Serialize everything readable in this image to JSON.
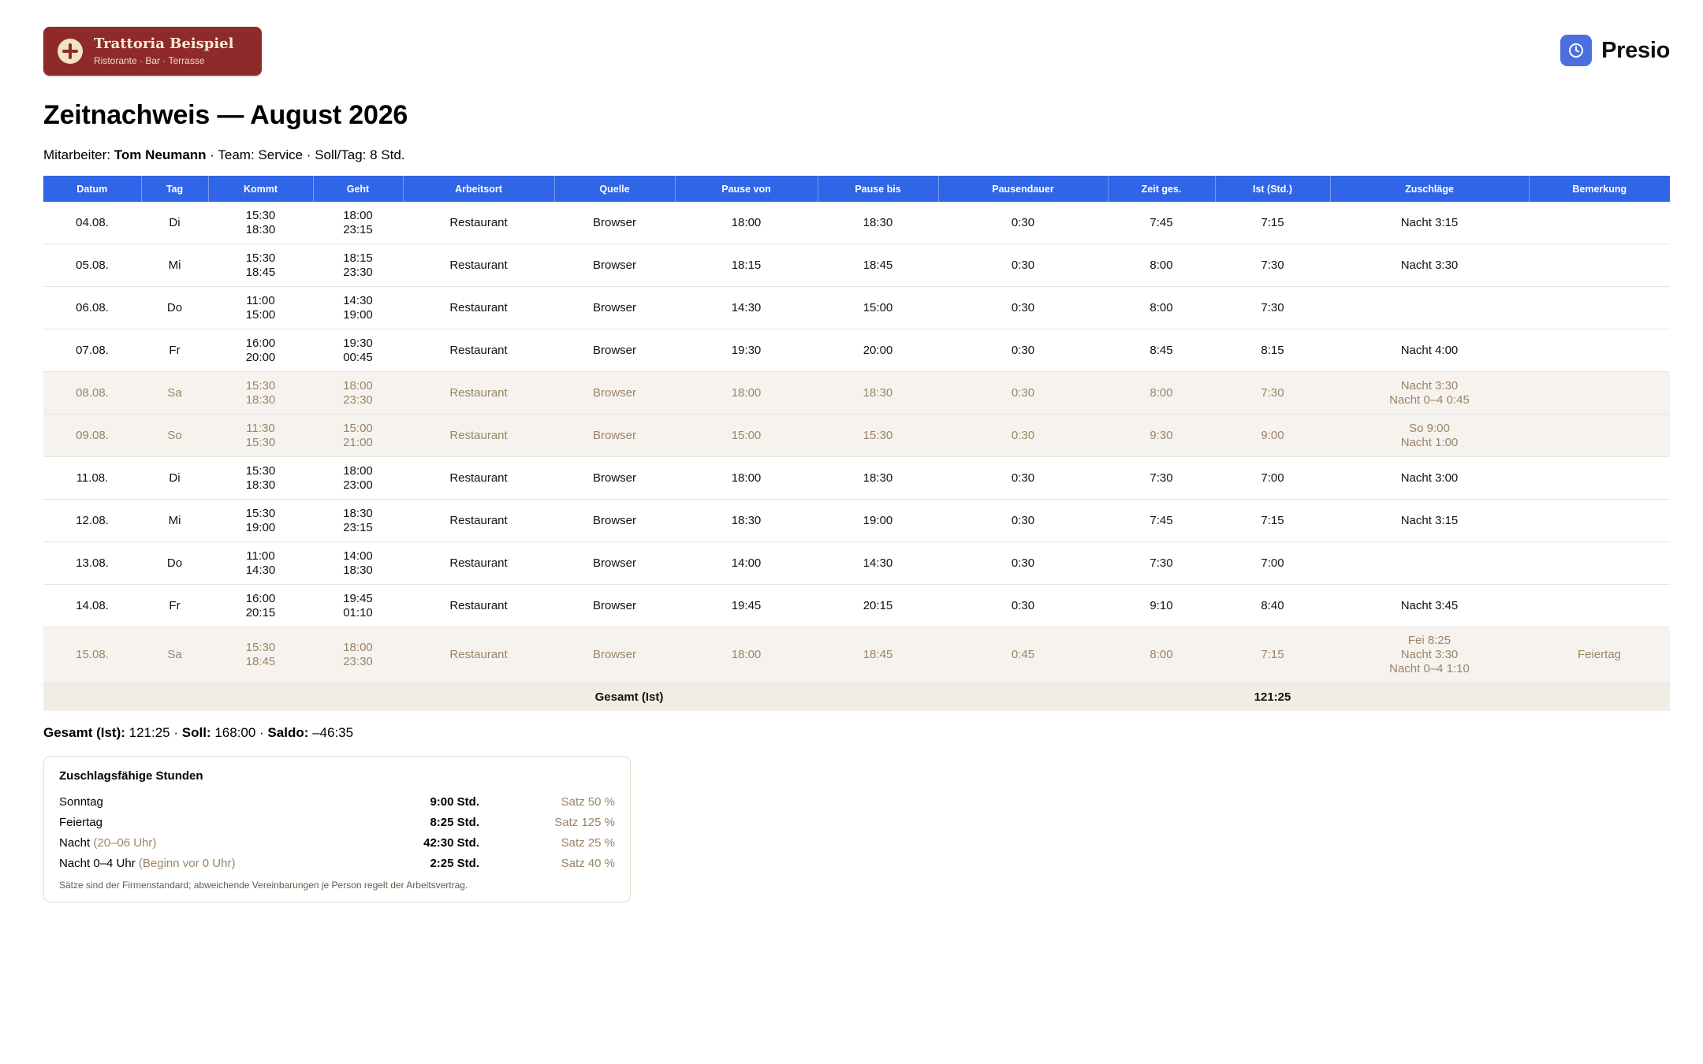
{
  "header": {
    "logo_name": "Trattoria Beispiel",
    "logo_subtitle": "Ristorante · Bar · Terrasse",
    "brand_name": "Presio"
  },
  "title": "Zeitnachweis — August 2026",
  "meta": {
    "employee_label": "Mitarbeiter:",
    "employee_name": "Tom Neumann",
    "rest": " · Team: Service · Soll/Tag: 8 Std."
  },
  "table": {
    "columns": [
      "Datum",
      "Tag",
      "Kommt",
      "Geht",
      "Arbeitsort",
      "Quelle",
      "Pause von",
      "Pause bis",
      "Pausendauer",
      "Zeit ges.",
      "Ist (Std.)",
      "Zuschläge",
      "Bemerkung"
    ],
    "rows": [
      {
        "datum": "04.08.",
        "tag": "Di",
        "kommt": [
          "15:30",
          "18:30"
        ],
        "geht": [
          "18:00",
          "23:15"
        ],
        "ort": "Restaurant",
        "quelle": "Browser",
        "pause_von": "18:00",
        "pause_bis": "18:30",
        "pausendauer": "0:30",
        "zeit": "7:45",
        "ist": "7:15",
        "zuschlaege": [
          "Nacht 3:15"
        ],
        "bemerkung": "",
        "weekend": false
      },
      {
        "datum": "05.08.",
        "tag": "Mi",
        "kommt": [
          "15:30",
          "18:45"
        ],
        "geht": [
          "18:15",
          "23:30"
        ],
        "ort": "Restaurant",
        "quelle": "Browser",
        "pause_von": "18:15",
        "pause_bis": "18:45",
        "pausendauer": "0:30",
        "zeit": "8:00",
        "ist": "7:30",
        "zuschlaege": [
          "Nacht 3:30"
        ],
        "bemerkung": "",
        "weekend": false
      },
      {
        "datum": "06.08.",
        "tag": "Do",
        "kommt": [
          "11:00",
          "15:00"
        ],
        "geht": [
          "14:30",
          "19:00"
        ],
        "ort": "Restaurant",
        "quelle": "Browser",
        "pause_von": "14:30",
        "pause_bis": "15:00",
        "pausendauer": "0:30",
        "zeit": "8:00",
        "ist": "7:30",
        "zuschlaege": [],
        "bemerkung": "",
        "weekend": false
      },
      {
        "datum": "07.08.",
        "tag": "Fr",
        "kommt": [
          "16:00",
          "20:00"
        ],
        "geht": [
          "19:30",
          "00:45"
        ],
        "ort": "Restaurant",
        "quelle": "Browser",
        "pause_von": "19:30",
        "pause_bis": "20:00",
        "pausendauer": "0:30",
        "zeit": "8:45",
        "ist": "8:15",
        "zuschlaege": [
          "Nacht 4:00"
        ],
        "bemerkung": "",
        "weekend": false
      },
      {
        "datum": "08.08.",
        "tag": "Sa",
        "kommt": [
          "15:30",
          "18:30"
        ],
        "geht": [
          "18:00",
          "23:30"
        ],
        "ort": "Restaurant",
        "quelle": "Browser",
        "pause_von": "18:00",
        "pause_bis": "18:30",
        "pausendauer": "0:30",
        "zeit": "8:00",
        "ist": "7:30",
        "zuschlaege": [
          "Nacht 3:30",
          "Nacht 0–4 0:45"
        ],
        "bemerkung": "",
        "weekend": true
      },
      {
        "datum": "09.08.",
        "tag": "So",
        "kommt": [
          "11:30",
          "15:30"
        ],
        "geht": [
          "15:00",
          "21:00"
        ],
        "ort": "Restaurant",
        "quelle": "Browser",
        "pause_von": "15:00",
        "pause_bis": "15:30",
        "pausendauer": "0:30",
        "zeit": "9:30",
        "ist": "9:00",
        "zuschlaege": [
          "So 9:00",
          "Nacht 1:00"
        ],
        "bemerkung": "",
        "weekend": true
      },
      {
        "datum": "11.08.",
        "tag": "Di",
        "kommt": [
          "15:30",
          "18:30"
        ],
        "geht": [
          "18:00",
          "23:00"
        ],
        "ort": "Restaurant",
        "quelle": "Browser",
        "pause_von": "18:00",
        "pause_bis": "18:30",
        "pausendauer": "0:30",
        "zeit": "7:30",
        "ist": "7:00",
        "zuschlaege": [
          "Nacht 3:00"
        ],
        "bemerkung": "",
        "weekend": false
      },
      {
        "datum": "12.08.",
        "tag": "Mi",
        "kommt": [
          "15:30",
          "19:00"
        ],
        "geht": [
          "18:30",
          "23:15"
        ],
        "ort": "Restaurant",
        "quelle": "Browser",
        "pause_von": "18:30",
        "pause_bis": "19:00",
        "pausendauer": "0:30",
        "zeit": "7:45",
        "ist": "7:15",
        "zuschlaege": [
          "Nacht 3:15"
        ],
        "bemerkung": "",
        "weekend": false
      },
      {
        "datum": "13.08.",
        "tag": "Do",
        "kommt": [
          "11:00",
          "14:30"
        ],
        "geht": [
          "14:00",
          "18:30"
        ],
        "ort": "Restaurant",
        "quelle": "Browser",
        "pause_von": "14:00",
        "pause_bis": "14:30",
        "pausendauer": "0:30",
        "zeit": "7:30",
        "ist": "7:00",
        "zuschlaege": [],
        "bemerkung": "",
        "weekend": false
      },
      {
        "datum": "14.08.",
        "tag": "Fr",
        "kommt": [
          "16:00",
          "20:15"
        ],
        "geht": [
          "19:45",
          "01:10"
        ],
        "ort": "Restaurant",
        "quelle": "Browser",
        "pause_von": "19:45",
        "pause_bis": "20:15",
        "pausendauer": "0:30",
        "zeit": "9:10",
        "ist": "8:40",
        "zuschlaege": [
          "Nacht 3:45"
        ],
        "bemerkung": "",
        "weekend": false
      },
      {
        "datum": "15.08.",
        "tag": "Sa",
        "kommt": [
          "15:30",
          "18:45"
        ],
        "geht": [
          "18:00",
          "23:30"
        ],
        "ort": "Restaurant",
        "quelle": "Browser",
        "pause_von": "18:00",
        "pause_bis": "18:45",
        "pausendauer": "0:45",
        "zeit": "8:00",
        "ist": "7:15",
        "zuschlaege": [
          "Fei 8:25",
          "Nacht 3:30",
          "Nacht 0–4 1:10"
        ],
        "bemerkung": "Feiertag",
        "weekend": true
      }
    ],
    "total_label": "Gesamt (Ist)",
    "total_value": "121:25"
  },
  "summary": {
    "ist_label": "Gesamt (Ist):",
    "ist_value": " 121:25 · ",
    "soll_label": "Soll:",
    "soll_value": " 168:00 · ",
    "saldo_label": "Saldo:",
    "saldo_value": " –46:35"
  },
  "surcharges": {
    "title": "Zuschlagsfähige Stunden",
    "rows": [
      {
        "label": "Sonntag",
        "hint": "",
        "hours": "9:00 Std.",
        "rate": "Satz 50 %"
      },
      {
        "label": "Feiertag",
        "hint": "",
        "hours": "8:25 Std.",
        "rate": "Satz 125 %"
      },
      {
        "label": "Nacht",
        "hint": " (20–06 Uhr)",
        "hours": "42:30 Std.",
        "rate": "Satz 25 %"
      },
      {
        "label": "Nacht 0–4 Uhr",
        "hint": " (Beginn vor 0 Uhr)",
        "hours": "2:25 Std.",
        "rate": "Satz 40 %"
      }
    ],
    "note": "Sätze sind der Firmenstandard; abweichende Vereinbarungen je Person regelt der Arbeitsvertrag."
  },
  "colors": {
    "header_blue": "#2f65e6",
    "logo_red": "#8e2a2a",
    "weekend_bg": "#f6f3ee",
    "weekend_text": "#9b8466",
    "brand_blue": "#4a6fe0"
  }
}
